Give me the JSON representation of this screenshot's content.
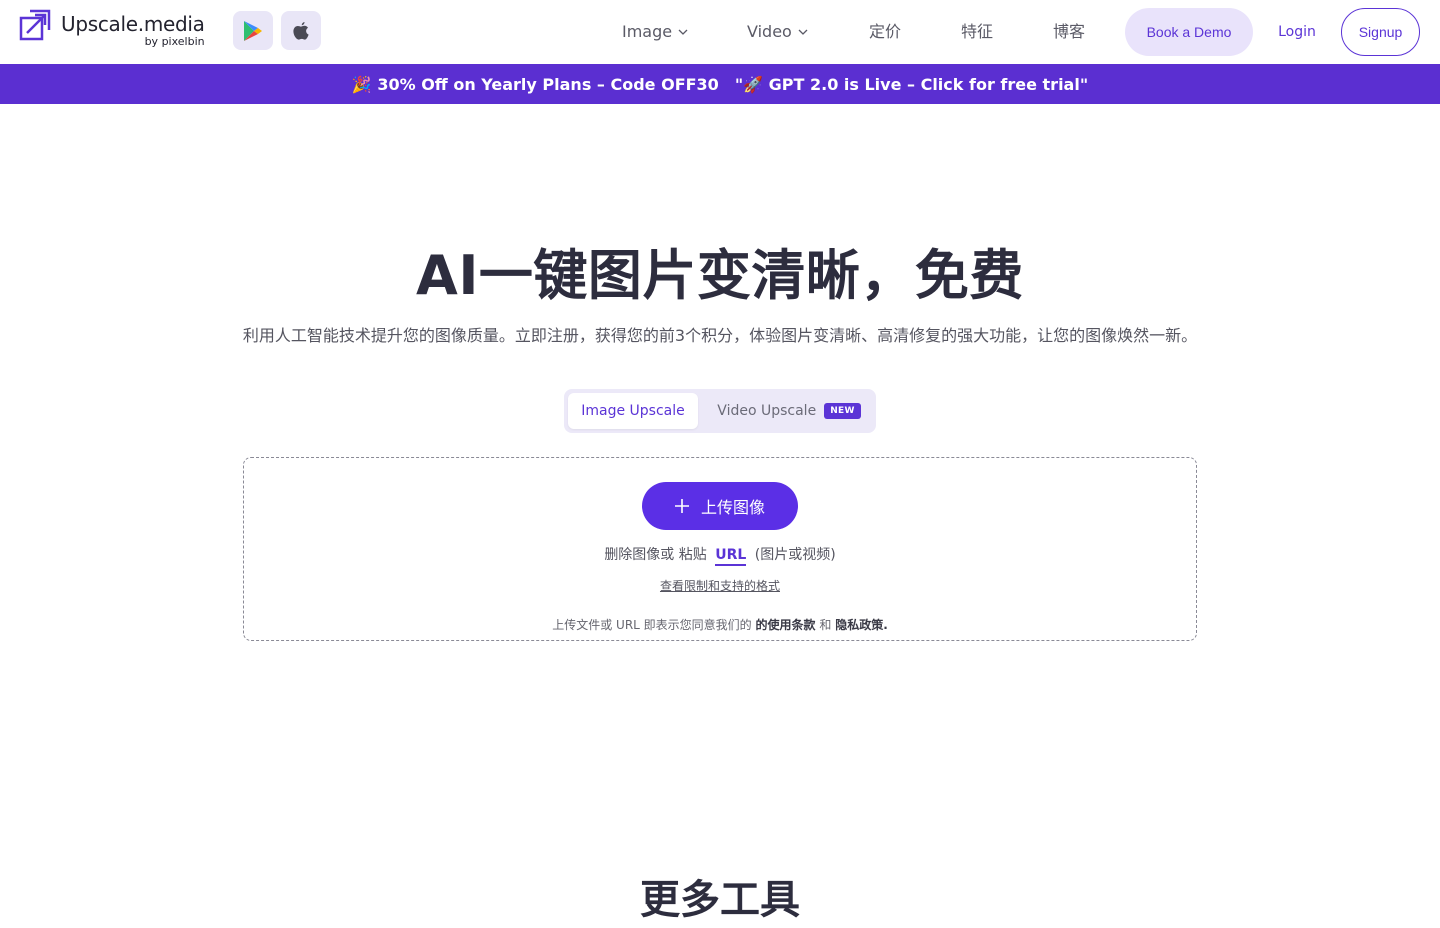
{
  "brand": {
    "name": "Upscale.media",
    "byline": "by pixelbin",
    "accent": "#5b34d6"
  },
  "store_links": [
    {
      "icon": "google-play-icon"
    },
    {
      "icon": "apple-icon"
    }
  ],
  "nav": {
    "image": "Image",
    "video": "Video",
    "pricing": "定价",
    "features": "特征",
    "blog": "博客",
    "book_demo": "Book a Demo",
    "login": "Login",
    "signup": "Signup"
  },
  "banner": {
    "promo": "🎉 30% Off on Yearly Plans – Code OFF30",
    "announcement": "\"🚀 GPT 2.0 is Live – Click for free trial\"",
    "background": "#5b2fd1"
  },
  "hero": {
    "title": "AI一键图片变清晰，免费",
    "subtitle": "利用人工智能技术提升您的图像质量。立即注册，获得您的前3个积分，体验图片变清晰、高清修复的强大功能，让您的图像焕然一新。"
  },
  "tabs": {
    "image": "Image Upscale",
    "video": "Video Upscale",
    "video_badge": "NEW"
  },
  "upload": {
    "button": "上传图像",
    "hint_prefix": "删除图像或 粘贴",
    "url": "URL",
    "hint_suffix": "(图片或视频)",
    "limits_link": "查看限制和支持的格式",
    "terms_prefix": "上传文件或 URL 即表示您同意我们的",
    "terms_link": "的使用条款",
    "terms_and": "和",
    "privacy_link": "隐私政策."
  },
  "more_tools": {
    "title": "更多工具"
  }
}
